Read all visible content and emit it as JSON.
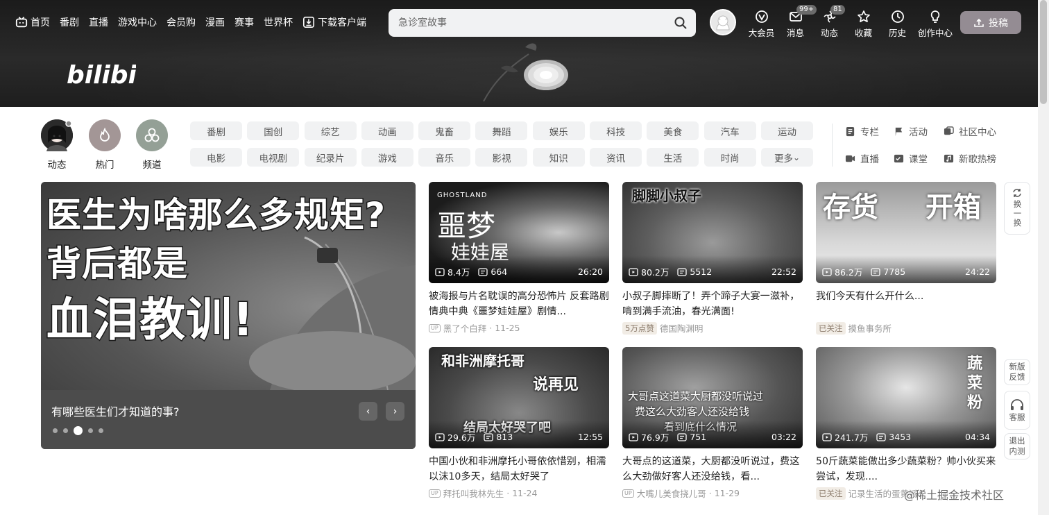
{
  "topnav": {
    "items": [
      {
        "label": "首页",
        "icon": "tv-icon"
      },
      {
        "label": "番剧"
      },
      {
        "label": "直播"
      },
      {
        "label": "游戏中心"
      },
      {
        "label": "会员购"
      },
      {
        "label": "漫画"
      },
      {
        "label": "赛事"
      },
      {
        "label": "世界杯"
      },
      {
        "label": "下载客户端",
        "icon": "download-icon"
      }
    ]
  },
  "search": {
    "placeholder": "急诊室故事"
  },
  "user_nav": {
    "items": [
      {
        "label": "大会员",
        "icon": "vip-icon",
        "badge": ""
      },
      {
        "label": "消息",
        "icon": "message-icon",
        "badge": "99+"
      },
      {
        "label": "动态",
        "icon": "dynamic-icon",
        "badge": "81"
      },
      {
        "label": "收藏",
        "icon": "star-icon",
        "badge": ""
      },
      {
        "label": "历史",
        "icon": "clock-icon",
        "badge": ""
      },
      {
        "label": "创作中心",
        "icon": "bulb-icon",
        "badge": ""
      }
    ],
    "upload_label": "投稿"
  },
  "logo_text": "bilibili",
  "quick": [
    {
      "label": "动态"
    },
    {
      "label": "热门"
    },
    {
      "label": "频道"
    }
  ],
  "channels": [
    "番剧",
    "国创",
    "综艺",
    "动画",
    "鬼畜",
    "舞蹈",
    "娱乐",
    "科技",
    "美食",
    "汽车",
    "运动",
    "电影",
    "电视剧",
    "纪录片",
    "游戏",
    "音乐",
    "影视",
    "知识",
    "资讯",
    "生活",
    "时尚",
    "更多"
  ],
  "extra_links": [
    {
      "label": "专栏",
      "icon": "article-icon"
    },
    {
      "label": "活动",
      "icon": "flag-icon"
    },
    {
      "label": "社区中心",
      "icon": "community-icon"
    },
    {
      "label": "直播",
      "icon": "live-icon"
    },
    {
      "label": "课堂",
      "icon": "class-icon"
    },
    {
      "label": "新歌热榜",
      "icon": "music-icon"
    }
  ],
  "carousel": {
    "overlay_lines": [
      "医生为啥那么多规矩?",
      "背后都是",
      "血泪教训!"
    ],
    "title": "有哪些医生们才知道的事?",
    "active_index": 2,
    "count": 5
  },
  "cards": [
    {
      "views": "8.4万",
      "danmaku": "664",
      "duration": "26:20",
      "title": "被海报与片名耽误的高分恐怖片 反套路剧情典中典《噩梦娃娃屋》剧情...",
      "tag": "",
      "author": "黑了个白拜",
      "date": "11-25",
      "overlay": "噩梦",
      "overlay2": "娃娃屋",
      "overlay3": "GHOSTLAND"
    },
    {
      "views": "80.2万",
      "danmaku": "5512",
      "duration": "22:52",
      "title": "小叔子脚摔断了！弄个蹄子大宴一滋补，啃到满手流油，春光满面!",
      "tag": "5万点赞",
      "author": "德国陶渊明",
      "date": "",
      "overlay": "脚脚小叔子",
      "overlay2": "",
      "overlay3": ""
    },
    {
      "views": "86.2万",
      "danmaku": "7785",
      "duration": "24:22",
      "title": "我们今天有什么开什么...",
      "tag": "已关注",
      "author": "摸鱼事务所",
      "date": "",
      "overlay": "存货",
      "overlay2": "开箱",
      "overlay3": ""
    },
    {
      "views": "29.6万",
      "danmaku": "813",
      "duration": "12:55",
      "title": "中国小伙和非洲摩托小哥依依惜别，相濡以沫10多天，结局太好哭了",
      "tag": "",
      "author": "拜托叫我林先生",
      "date": "11-24",
      "overlay": "和非洲摩托哥",
      "overlay2": "说再见",
      "overlay3": "结局太好哭了吧"
    },
    {
      "views": "76.9万",
      "danmaku": "751",
      "duration": "03:22",
      "title": "大哥点的这道菜，大厨都没听说过，费这么大劲做好客人还没给钱，看...",
      "tag": "",
      "author": "大嘴儿美食挠儿哥",
      "date": "11-29",
      "overlay": "大哥点这道菜大厨都没听说过",
      "overlay2": "费这么大劲客人还没给钱",
      "overlay3": "看到底什么情况"
    },
    {
      "views": "241.7万",
      "danmaku": "3453",
      "duration": "04:34",
      "title": "50斤蔬菜能做出多少蔬菜粉？帅小伙买来尝试，发现....",
      "tag": "已关注",
      "author": "记录生活的蛋黄派",
      "date": "",
      "overlay": "蔬",
      "overlay2": "菜",
      "overlay3": "粉"
    }
  ],
  "float_buttons": {
    "refresh": "换一换",
    "feedback": "新版反馈",
    "service": "客服",
    "exit": "退出内测"
  },
  "watermark": "@稀土掘金技术社区"
}
